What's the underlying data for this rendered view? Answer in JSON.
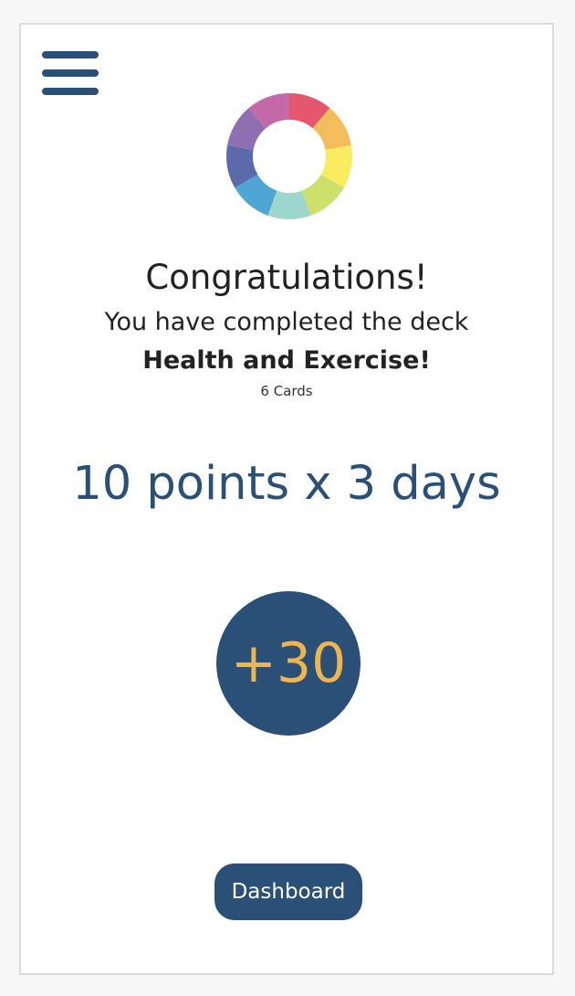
{
  "menu": {
    "icon": "hamburger-menu-icon"
  },
  "logo": {
    "icon": "color-wheel-logo",
    "colors": [
      "#e5566f",
      "#f4bd5c",
      "#f9ec5e",
      "#cde06b",
      "#9dd6cd",
      "#4fa5d4",
      "#5b6aab",
      "#8d6fb2",
      "#c469a8"
    ]
  },
  "completion": {
    "title": "Congratulations!",
    "message": "You have completed the deck",
    "deck_name": "Health and Exercise!",
    "card_count": "6 Cards"
  },
  "points": {
    "formula": "10 points x 3 days",
    "total": "+30"
  },
  "actions": {
    "dashboard_label": "Dashboard"
  },
  "colors": {
    "primary": "#2a5078",
    "accent": "#f0b54a",
    "background": "#ffffff"
  }
}
